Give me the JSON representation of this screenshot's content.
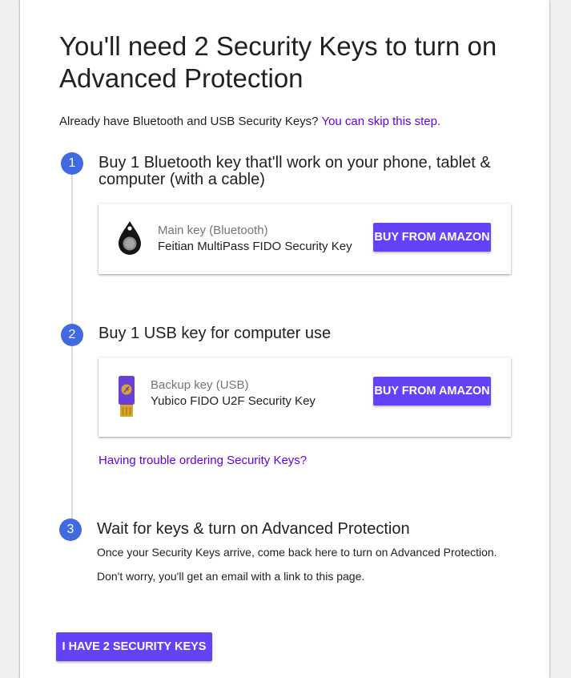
{
  "title": "You'll need 2 Security Keys to turn on Advanced Protection",
  "intro": {
    "text": "Already have Bluetooth and USB Security Keys?",
    "skip_link": "You can skip this step."
  },
  "steps": [
    {
      "number": "1",
      "title": "Buy 1 Bluetooth key that'll work on your phone, tablet & computer (with a cable)",
      "product": {
        "icon": "bluetooth-key-icon",
        "label": "Main key (Bluetooth)",
        "name": "Feitian MultiPass FIDO Security Key",
        "button": "BUY FROM AMAZON"
      }
    },
    {
      "number": "2",
      "title": "Buy 1 USB key for computer use",
      "product": {
        "icon": "usb-key-icon",
        "label": "Backup key (USB)",
        "name": "Yubico FIDO U2F Security Key",
        "button": "BUY FROM AMAZON"
      },
      "trouble_link": "Having trouble ordering Security Keys?"
    },
    {
      "number": "3",
      "title": "Wait for keys & turn on Advanced Protection",
      "lines": [
        "Once your Security Keys arrive, come back here to turn on Advanced Protection.",
        "Don't worry, you'll get an email with a link to this page."
      ]
    }
  ],
  "primary_button": "I HAVE 2 SECURITY KEYS",
  "colors": {
    "accent": "#6442f5",
    "link": "#6200ee",
    "step_circle": "#4169e1",
    "timeline": "#dadce0"
  }
}
